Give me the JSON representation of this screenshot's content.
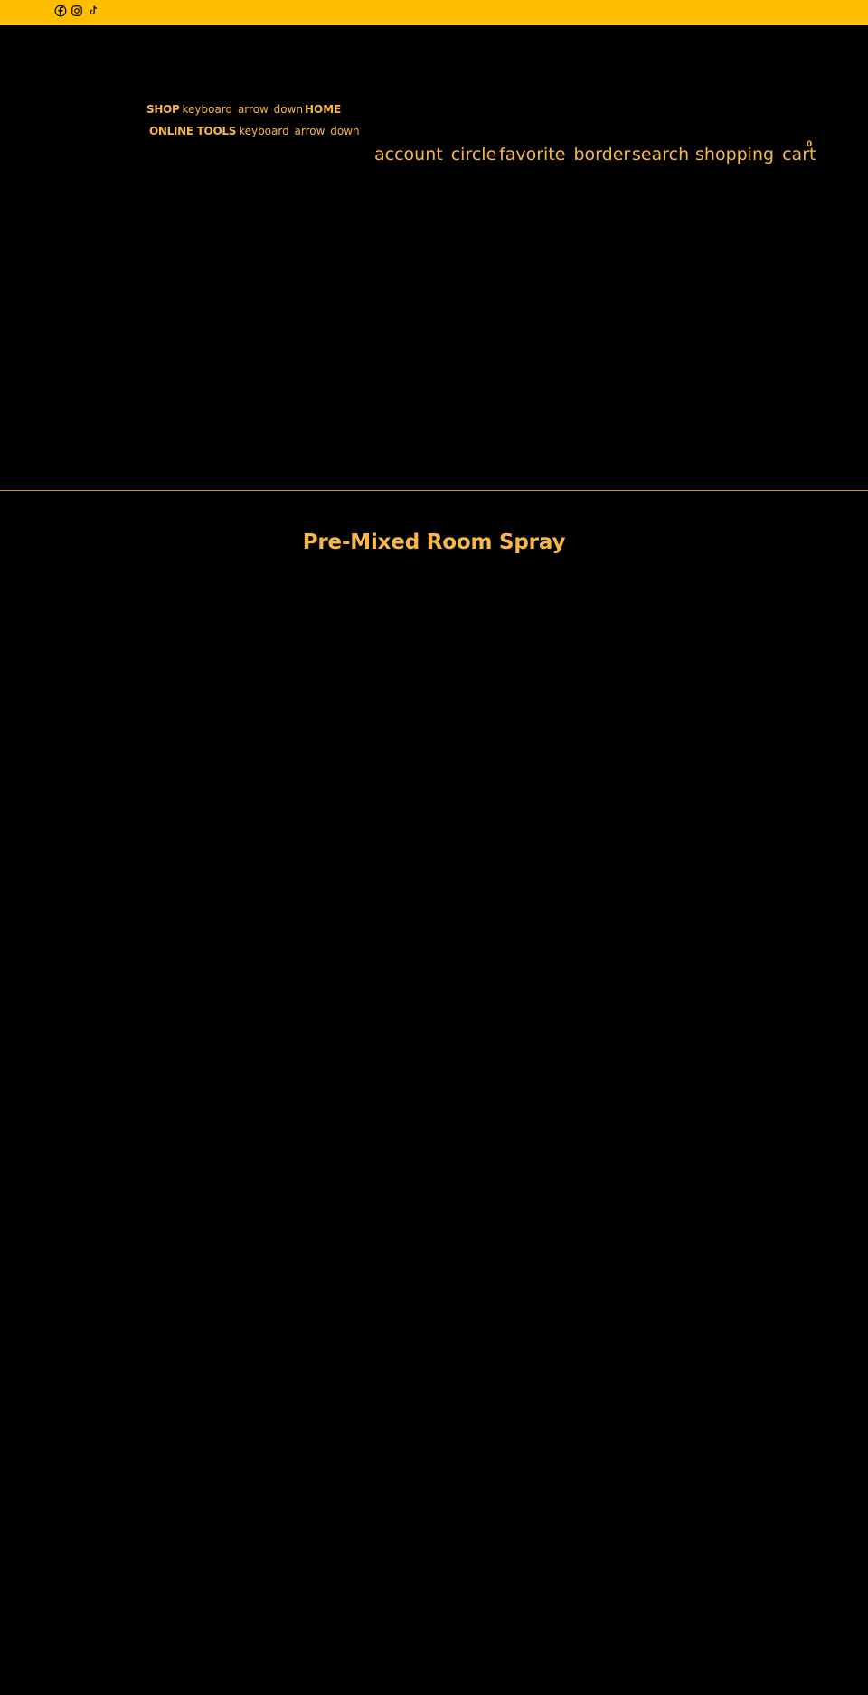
{
  "topbar": {
    "background": "#FFBE00",
    "social_icons": [
      "facebook-icon",
      "instagram-icon",
      "tiktok-icon"
    ]
  },
  "nav": {
    "shop": {
      "label": "SHOP",
      "icon_text": "keyboard_arrow_down"
    },
    "home": {
      "label": "HOME"
    },
    "online_tools": {
      "label": "ONLINE TOOLS",
      "icon_text": "keyboard_arrow_down"
    }
  },
  "utilities": {
    "account": "account_circle",
    "favorite": "favorite_border",
    "search": "search",
    "cart": "shopping_cart",
    "cart_count": "0"
  },
  "page": {
    "title": "Pre-Mixed Room Spray"
  },
  "colors": {
    "accent": "#F6B84B",
    "background": "#000000",
    "divider": "#C9963E"
  }
}
